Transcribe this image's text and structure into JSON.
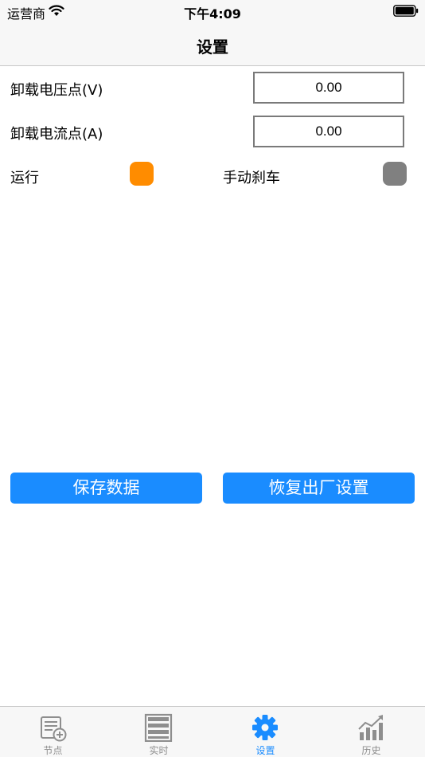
{
  "status_bar": {
    "carrier": "运营商",
    "time": "下午4:09"
  },
  "nav": {
    "title": "设置"
  },
  "fields": [
    {
      "label": "卸载电压点(V)",
      "value": "0.00"
    },
    {
      "label": "卸载电流点(A)",
      "value": "0.00"
    }
  ],
  "indicators": [
    {
      "label": "运行",
      "color": "#ff8c00"
    },
    {
      "label": "手动刹车",
      "color": "#808080"
    }
  ],
  "buttons": {
    "save": "保存数据",
    "restore": "恢复出厂设置"
  },
  "colors": {
    "accent": "#1a8cff",
    "inactive_tab": "#8e8e8e"
  },
  "tabs": [
    {
      "label": "节点",
      "icon": "node-add-icon",
      "active": false
    },
    {
      "label": "实时",
      "icon": "realtime-list-icon",
      "active": false
    },
    {
      "label": "设置",
      "icon": "gear-icon",
      "active": true
    },
    {
      "label": "历史",
      "icon": "history-chart-icon",
      "active": false
    }
  ]
}
